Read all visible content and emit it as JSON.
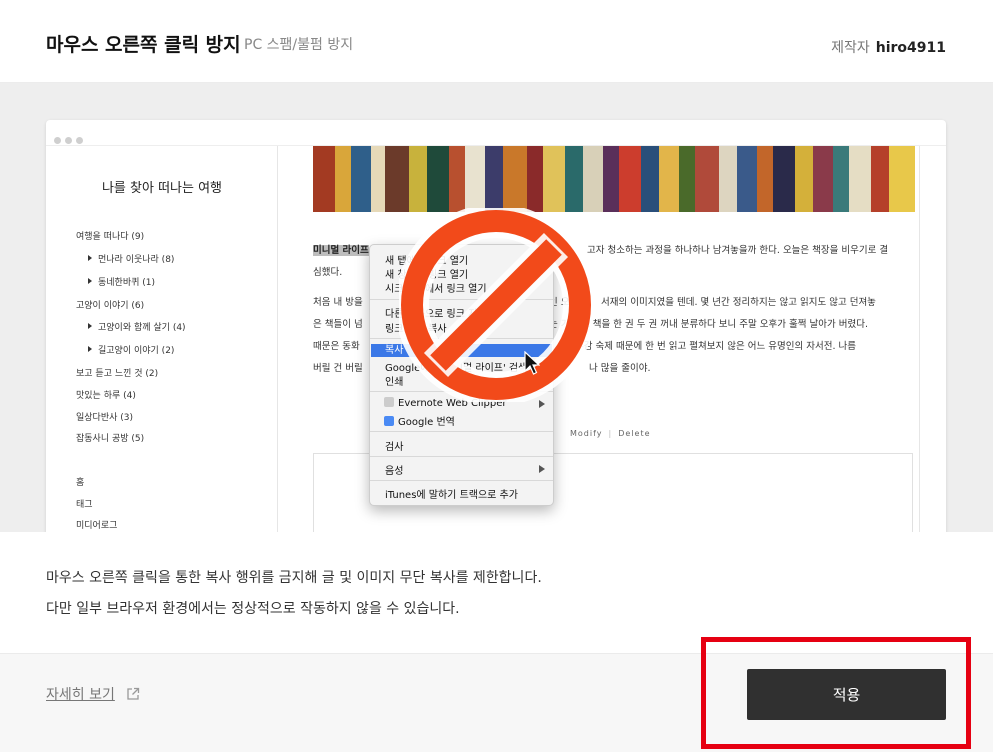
{
  "header": {
    "title": "마우스 오른쪽 클릭 방지",
    "subtitle": "PC 스팸/불펌 방지",
    "creator_label": "제작자",
    "creator_name": "hiro4911"
  },
  "preview": {
    "blog_title": "나를 찾아 떠나는 여행",
    "categories": [
      {
        "label": "여행을 떠나다 (9)",
        "sub": false
      },
      {
        "label": "먼나라 이웃나라 (8)",
        "sub": true
      },
      {
        "label": "동네한바퀴 (1)",
        "sub": true
      },
      {
        "label": "고양이 이야기 (6)",
        "sub": false
      },
      {
        "label": "고양이와 함께 살기 (4)",
        "sub": true
      },
      {
        "label": "길고양이 이야기 (2)",
        "sub": true
      },
      {
        "label": "보고 듣고 느낀 것 (2)",
        "sub": false
      },
      {
        "label": "맛있는 하루 (4)",
        "sub": false
      },
      {
        "label": "일상다반사 (3)",
        "sub": false
      },
      {
        "label": "잡동사니 공방 (5)",
        "sub": false
      }
    ],
    "nav": [
      "홈",
      "태그",
      "미디어로그"
    ],
    "post": {
      "highlight": "미니멀 라이프",
      "p1_rest": "고자 청소하는 과정을 하나하나 남겨놓을까 한다. 오늘은 책장을 비우기로 결",
      "p1_line2": "심했다.",
      "p2_line1_a": "처음 내 방을",
      "p2_line1_b": "인 오",
      "p2_line1_c": "서재의 이미지였을 텐데. 몇 년간 정리하지는 않고 읽지도 않고 던져놓",
      "p2_line2_a": "은 책들이 넘",
      "p2_line2_b": "는 가",
      "p2_line2_c": "로 책을 한 권 두 권 꺼내 분류하다 보니 주말 오후가 훌쩍 날아가 버렸다.",
      "p2_line3_a": "때문은 동화",
      "p2_line3_b": "진",
      "p2_line3_c": "후감 숙제 때문에 한 번 읽고 펼쳐보지 않은 어느 유명인의 자서전. 나름",
      "p2_line4_a": "버릴 건 버릴",
      "p2_line4_b": "나 많을 줄이야.",
      "actions": [
        "Modify",
        "Delete"
      ]
    },
    "context_menu": {
      "items": [
        "새 탭에서 링크 열기",
        "새 창에서 링크 열기",
        "시크릿 창에서 링크 열기",
        "다른 이름으로 링크 저장...",
        "링크 주소 복사",
        "복사",
        "Google에서 '미니멀 라이프' 검색",
        "인쇄",
        "Evernote Web Clipper",
        "Google 번역",
        "검사",
        "음성",
        "iTunes에 말하기 트랙으로 추가"
      ]
    }
  },
  "description": {
    "line1": "마우스 오른쪽 클릭을 통한 복사 행위를 금지해 글 및 이미지 무단 복사를 제한합니다.",
    "line2": "다만 일부 브라우저 환경에서는 정상적으로 작동하지 않을 수 있습니다."
  },
  "footer": {
    "details_link": "자세히 보기",
    "apply_button": "적용"
  },
  "colors": {
    "apply_button_bg": "#303030",
    "highlight_box": "#e60012",
    "no_sign": "#f24a1a",
    "menu_selected": "#3b78e7"
  }
}
